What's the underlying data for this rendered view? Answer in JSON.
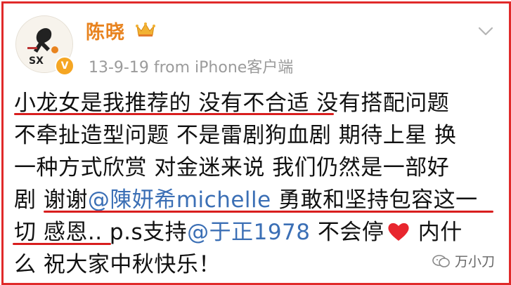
{
  "post": {
    "author": "陈晓",
    "meta": "13-9-19  from iPhone客户端",
    "avatar_text": "SX",
    "lines": {
      "l1": "小龙女是我推荐的 没有不合适 没有搭配问题",
      "l2": "不牵扯造型问题 不是雷剧狗血剧 期待上星 换",
      "l3": "一种方式欣赏 对金迷来说 我们仍然是一部好",
      "l4a": "剧 谢谢",
      "l4m": "@陳妍希michelle",
      "l4b": " 勇敢和坚持包容这一",
      "l5a": "切 感恩.. p.s支持",
      "l5m": "@于正1978",
      "l5b": " 不会停",
      "l5c": " 内什",
      "l6": "么 祝大家中秋快乐！"
    }
  },
  "watermark": "万小刀",
  "colors": {
    "frame": "#e02a2a",
    "name": "#e8831f",
    "mention": "#3b6fb5",
    "underline": "#d81e1e"
  }
}
